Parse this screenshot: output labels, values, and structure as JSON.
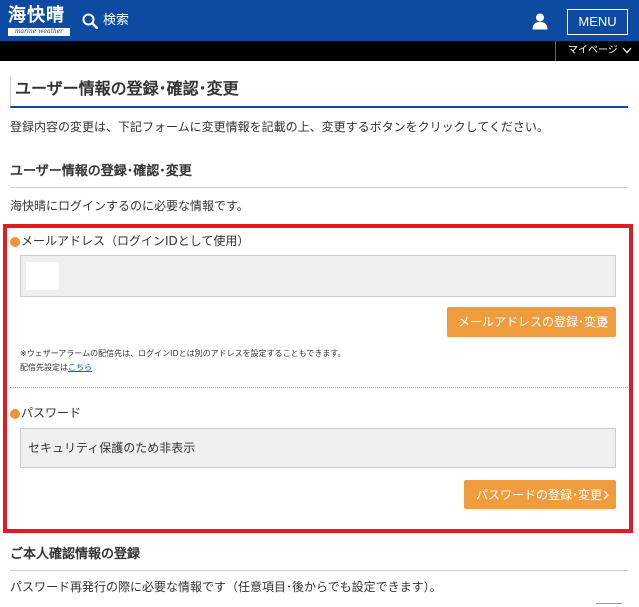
{
  "header": {
    "logo_text": "海快晴",
    "logo_sub": "marine weather",
    "search_label": "検索",
    "menu_label": "MENU",
    "bg_color": "#0d4aa1"
  },
  "subnav": {
    "mypage_label": "マイページ"
  },
  "page": {
    "title": "ユーザー情報の登録･確認･変更",
    "intro": "登録内容の変更は、下記フォームに変更情報を記載の上、変更するボタンをクリックしてください。"
  },
  "login_section": {
    "title": "ユーザー情報の登録･確認･変更",
    "description": "海快晴にログインするのに必要な情報です。",
    "email": {
      "label": "メールアドレス（ログインIDとして使用）",
      "value": "",
      "button_label": "メールアドレスの登録･変更",
      "note_line1": "※ウェザーアラームの配信先は、ログインIDとは別のアドレスを設定することもできます。",
      "note_line2_prefix": "配信先設定は",
      "note_link": "こちら"
    },
    "password": {
      "label": "パスワード",
      "value": "セキュリティ保護のため非表示",
      "button_label": "パスワードの登録･変更"
    }
  },
  "identity_section": {
    "title": "ご本人確認情報の登録",
    "description": "パスワード再発行の際に必要な情報です（任意項目･後からでも設定できます）。"
  },
  "colors": {
    "accent_orange": "#ee9c3e",
    "bullet_orange": "#f0933a",
    "highlight_red": "#e01b24",
    "link_blue": "#1a5dc8"
  },
  "icons": {
    "search": "search-icon",
    "user": "user-icon",
    "chevron_down": "chevron-down-icon",
    "chevron_right": "chevron-right-icon"
  }
}
